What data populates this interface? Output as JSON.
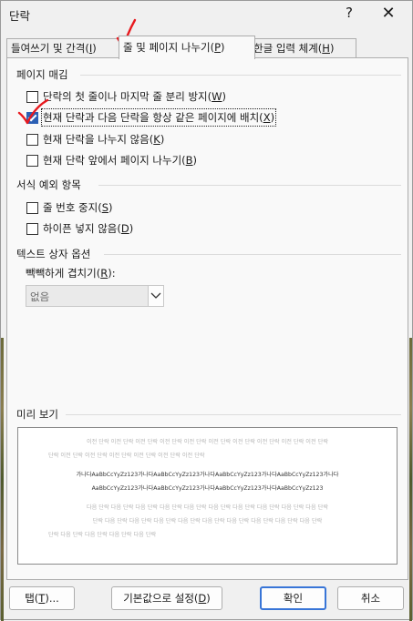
{
  "window": {
    "title": "단락",
    "help_label": "?",
    "close_label": "✕"
  },
  "tabs": [
    {
      "label": "들여쓰기 및 간격(",
      "key": "I",
      "suffix": ")"
    },
    {
      "label": "줄 및 페이지 나누기(",
      "key": "P",
      "suffix": ")"
    },
    {
      "label": "한글 입력 체계(",
      "key": "H",
      "suffix": ")"
    }
  ],
  "pagination": {
    "title": "페이지 매김",
    "options": [
      {
        "label": "단락의 첫 줄이나 마지막 줄 분리 방지(",
        "key": "W",
        "suffix": ")",
        "checked": false
      },
      {
        "label": "현재 단락과 다음 단락을 항상 같은 페이지에 배치(",
        "key": "X",
        "suffix": ")",
        "checked": true
      },
      {
        "label": "현재 단락을 나누지 않음(",
        "key": "K",
        "suffix": ")",
        "checked": false
      },
      {
        "label": "현재 단락 앞에서 페이지 나누기(",
        "key": "B",
        "suffix": ")",
        "checked": false
      }
    ]
  },
  "formatting_exceptions": {
    "title": "서식 예외 항목",
    "options": [
      {
        "label": "줄 번호 중지(",
        "key": "S",
        "suffix": ")",
        "checked": false
      },
      {
        "label": "하이픈 넣지 않음(",
        "key": "D",
        "suffix": ")",
        "checked": false
      }
    ]
  },
  "textbox_options": {
    "title": "텍스트 상자 옵션",
    "tight_wrap": {
      "label": "빽빽하게 겹치기(",
      "key": "R",
      "suffix": "):",
      "value": "없음"
    }
  },
  "preview": {
    "title": "미리 보기",
    "prev_lines": [
      "이전 단락 이전 단락 이전 단락 이전 단락 이전 단락 이전 단락 이전 단락 이전 단락 이전 단락 이전 단락",
      "단락 이전 단락 이전 단락 이전 단락 이전 단락 이전 단락 이전 단락"
    ],
    "sample_lines": [
      "가나다AaBbCcYyZz123가나다AaBbCcYyZz123가나다AaBbCcYyZz123가나다AaBbCcYyZz123가나다",
      "AaBbCcYyZz123가나다AaBbCcYyZz123가나다AaBbCcYyZz123가나다AaBbCcYyZz123"
    ],
    "next_lines": [
      "다음 단락 다음 단락 다음 단락 다음 단락 다음 단락 다음 단락 다음 단락 다음 단락 다음 단락 다음 단락",
      "단락 다음 단락 다음 단락 다음 단락 다음 단락 다음 단락 다음 단락 다음 단락 다음 단락 다음 단락",
      "단락 다음 단락 다음 단락 다음 단락 다음 단락"
    ]
  },
  "buttons": {
    "tabs_label": "탭(",
    "tabs_key": "T",
    "tabs_suffix": ")...",
    "default_label": "기본값으로 설정(",
    "default_key": "D",
    "default_suffix": ")",
    "ok_label": "확인",
    "cancel_label": "취소"
  },
  "colors": {
    "annotation": "#e8191e",
    "checkbox_accent": "#2b5fb4",
    "default_button_border": "#3875d7"
  },
  "annotations": [
    "checkmark-on-tab",
    "checkmark-on-checkbox"
  ]
}
